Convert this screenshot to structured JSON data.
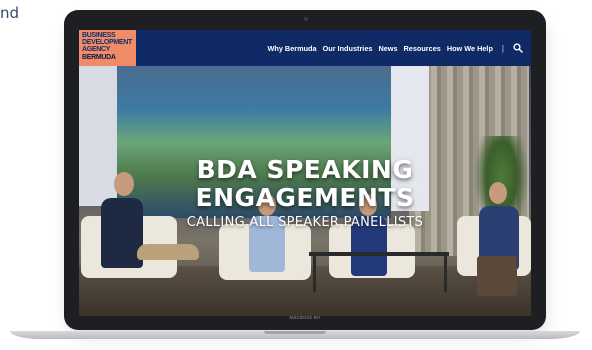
{
  "corner_text": "nd",
  "logo": {
    "lines": [
      "BUSINESS",
      "DEVELOPMENT",
      "AGENCY",
      "BERMUDA"
    ]
  },
  "nav": {
    "items": [
      "Why Bermuda",
      "Our Industries",
      "News",
      "Resources",
      "How We Help"
    ],
    "separator": "|",
    "search_icon": "search-icon"
  },
  "hero": {
    "title_line1": "BDA SPEAKING",
    "title_line2": "ENGAGEMENTS",
    "subtitle": "CALLING ALL SPEAKER PANELLISTS"
  },
  "device": {
    "model_label": "MacBook Air"
  },
  "colors": {
    "header_bg": "#102a66",
    "logo_bg": "#f08a67"
  }
}
